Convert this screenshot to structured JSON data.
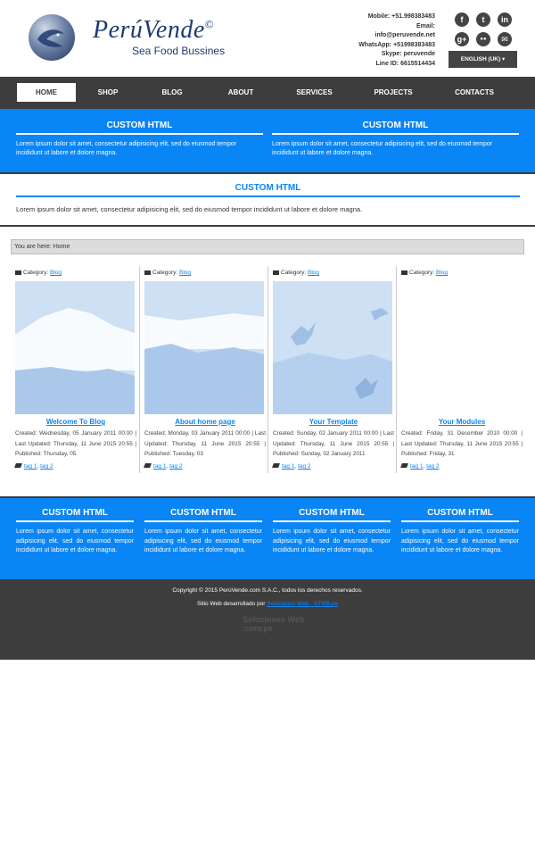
{
  "header": {
    "logo_title": "PerúVende",
    "logo_copy": "©",
    "logo_subtitle": "Sea Food Bussines",
    "contact": [
      "Mobile: +51.998383483",
      "Email:",
      "info@peruvende.net",
      "WhatsApp: +51998383483",
      "Skype: peruvende",
      "Line ID: 6615514434"
    ],
    "social": [
      "f",
      "t",
      "in",
      "g+",
      "●●",
      "✉"
    ],
    "language": "ENGLISH (UK) ▾"
  },
  "nav": {
    "items": [
      "HOME",
      "SHOP",
      "BLOG",
      "ABOUT",
      "SERVICES",
      "PROJECTS",
      "CONTACTS"
    ]
  },
  "blue_top": {
    "modules": [
      {
        "title": "CUSTOM HTML",
        "text": "Lorem ipsum dolor sit amet, consectetur adipisicing elit, sed do eiusmod tempor incididunt ut labore et dolore magna."
      },
      {
        "title": "CUSTOM HTML",
        "text": "Lorem ipsum dolor sit amet, consectetur adipisicing elit, sed do eiusmod tempor incididunt ut labore et dolore magna."
      }
    ]
  },
  "white_module": {
    "title": "CUSTOM HTML",
    "text": "Lorem ipsum dolor sit amet, consectetur adipisicing elit, sed do eiusmod tempor incididunt ut labore et dolore magna."
  },
  "breadcrumb": "You are here: Home",
  "articles": [
    {
      "category_label": "Category:",
      "category": "Blog",
      "title": "Welcome To Blog",
      "meta": "Created: Wednesday, 05 January 2011 00:00 | Last Updated: Thursday, 11 June 2015 20:55 | Published: Thursday, 05",
      "tag1": "tag 1",
      "tag2": "tag 2"
    },
    {
      "category_label": "Category:",
      "category": "Blog",
      "title": "About home page",
      "meta": "Created: Monday, 03 January 2011 00:00 | Last Updated: Thursday, 11 June 2015 20:55 | Published: Tuesday, 03",
      "tag1": "tag 1",
      "tag2": "tag 2"
    },
    {
      "category_label": "Category:",
      "category": "Blog",
      "title": "Your Template",
      "meta": "Created: Sunday, 02 January 2011 00:00 | Last Updated: Thursday, 11 June 2015 20:55 | Published: Sunday, 02 January 2011",
      "tag1": "tag 1",
      "tag2": "tag 2"
    },
    {
      "category_label": "Category:",
      "category": "Blog",
      "title": "Your Modules",
      "meta": "Created: Friday, 31 December 2010 00:00 | Last Updated: Thursday, 11 June 2015 20:55 | Published: Friday, 31",
      "tag1": "tag 1",
      "tag2": "tag 2"
    }
  ],
  "blue_bottom": {
    "modules": [
      {
        "title": "CUSTOM HTML",
        "text": "Lorem ipsum dolor sit amet, consectetur adipisicing elit, sed do eiusmod tempor incididunt ut labore et dolore magna."
      },
      {
        "title": "CUSTOM HTML",
        "text": "Lorem ipsum dolor sit amet, consectetur adipisicing elit, sed do eiusmod tempor incididunt ut labore et dolore magna."
      },
      {
        "title": "CUSTOM HTML",
        "text": "Lorem ipsum dolor sit amet, consectetur adipisicing elit, sed do eiusmod tempor incididunt ut labore et dolore magna."
      },
      {
        "title": "CUSTOM HTML",
        "text": "Lorem ipsum dolor sit amet, consectetur adipisicing elit, sed do eiusmod tempor incididunt ut labore et dolore magna."
      }
    ]
  },
  "footer": {
    "copyright": "Copyright © 2015 PerúVende.com S.A.C., todos los derechos reservados.",
    "developed_prefix": "Sitio Web desarrollado por ",
    "developed_link": "Soluciones Web - STMB.pe",
    "footer_logo": "Soluciones Web .com.pe"
  },
  "colors": {
    "accent": "#0a85f5",
    "dark": "#3d3d3d"
  }
}
